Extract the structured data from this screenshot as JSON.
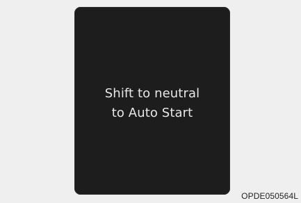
{
  "display": {
    "message_line_1": "Shift to neutral",
    "message_line_2": "to Auto Start"
  },
  "figure_code": "OPDE050564L",
  "colors": {
    "page_background": "#efefef",
    "display_background": "#1d1d1d",
    "message_text": "#e8e8e8"
  }
}
